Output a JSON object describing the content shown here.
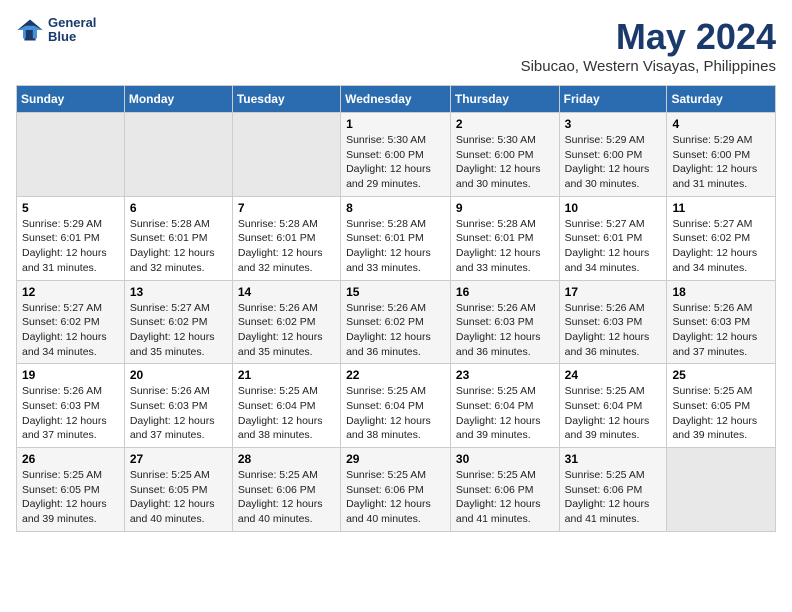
{
  "logo": {
    "line1": "General",
    "line2": "Blue"
  },
  "title": "May 2024",
  "subtitle": "Sibucao, Western Visayas, Philippines",
  "days_header": [
    "Sunday",
    "Monday",
    "Tuesday",
    "Wednesday",
    "Thursday",
    "Friday",
    "Saturday"
  ],
  "weeks": [
    [
      {
        "num": "",
        "info": ""
      },
      {
        "num": "",
        "info": ""
      },
      {
        "num": "",
        "info": ""
      },
      {
        "num": "1",
        "info": "Sunrise: 5:30 AM\nSunset: 6:00 PM\nDaylight: 12 hours\nand 29 minutes."
      },
      {
        "num": "2",
        "info": "Sunrise: 5:30 AM\nSunset: 6:00 PM\nDaylight: 12 hours\nand 30 minutes."
      },
      {
        "num": "3",
        "info": "Sunrise: 5:29 AM\nSunset: 6:00 PM\nDaylight: 12 hours\nand 30 minutes."
      },
      {
        "num": "4",
        "info": "Sunrise: 5:29 AM\nSunset: 6:00 PM\nDaylight: 12 hours\nand 31 minutes."
      }
    ],
    [
      {
        "num": "5",
        "info": "Sunrise: 5:29 AM\nSunset: 6:01 PM\nDaylight: 12 hours\nand 31 minutes."
      },
      {
        "num": "6",
        "info": "Sunrise: 5:28 AM\nSunset: 6:01 PM\nDaylight: 12 hours\nand 32 minutes."
      },
      {
        "num": "7",
        "info": "Sunrise: 5:28 AM\nSunset: 6:01 PM\nDaylight: 12 hours\nand 32 minutes."
      },
      {
        "num": "8",
        "info": "Sunrise: 5:28 AM\nSunset: 6:01 PM\nDaylight: 12 hours\nand 33 minutes."
      },
      {
        "num": "9",
        "info": "Sunrise: 5:28 AM\nSunset: 6:01 PM\nDaylight: 12 hours\nand 33 minutes."
      },
      {
        "num": "10",
        "info": "Sunrise: 5:27 AM\nSunset: 6:01 PM\nDaylight: 12 hours\nand 34 minutes."
      },
      {
        "num": "11",
        "info": "Sunrise: 5:27 AM\nSunset: 6:02 PM\nDaylight: 12 hours\nand 34 minutes."
      }
    ],
    [
      {
        "num": "12",
        "info": "Sunrise: 5:27 AM\nSunset: 6:02 PM\nDaylight: 12 hours\nand 34 minutes."
      },
      {
        "num": "13",
        "info": "Sunrise: 5:27 AM\nSunset: 6:02 PM\nDaylight: 12 hours\nand 35 minutes."
      },
      {
        "num": "14",
        "info": "Sunrise: 5:26 AM\nSunset: 6:02 PM\nDaylight: 12 hours\nand 35 minutes."
      },
      {
        "num": "15",
        "info": "Sunrise: 5:26 AM\nSunset: 6:02 PM\nDaylight: 12 hours\nand 36 minutes."
      },
      {
        "num": "16",
        "info": "Sunrise: 5:26 AM\nSunset: 6:03 PM\nDaylight: 12 hours\nand 36 minutes."
      },
      {
        "num": "17",
        "info": "Sunrise: 5:26 AM\nSunset: 6:03 PM\nDaylight: 12 hours\nand 36 minutes."
      },
      {
        "num": "18",
        "info": "Sunrise: 5:26 AM\nSunset: 6:03 PM\nDaylight: 12 hours\nand 37 minutes."
      }
    ],
    [
      {
        "num": "19",
        "info": "Sunrise: 5:26 AM\nSunset: 6:03 PM\nDaylight: 12 hours\nand 37 minutes."
      },
      {
        "num": "20",
        "info": "Sunrise: 5:26 AM\nSunset: 6:03 PM\nDaylight: 12 hours\nand 37 minutes."
      },
      {
        "num": "21",
        "info": "Sunrise: 5:25 AM\nSunset: 6:04 PM\nDaylight: 12 hours\nand 38 minutes."
      },
      {
        "num": "22",
        "info": "Sunrise: 5:25 AM\nSunset: 6:04 PM\nDaylight: 12 hours\nand 38 minutes."
      },
      {
        "num": "23",
        "info": "Sunrise: 5:25 AM\nSunset: 6:04 PM\nDaylight: 12 hours\nand 39 minutes."
      },
      {
        "num": "24",
        "info": "Sunrise: 5:25 AM\nSunset: 6:04 PM\nDaylight: 12 hours\nand 39 minutes."
      },
      {
        "num": "25",
        "info": "Sunrise: 5:25 AM\nSunset: 6:05 PM\nDaylight: 12 hours\nand 39 minutes."
      }
    ],
    [
      {
        "num": "26",
        "info": "Sunrise: 5:25 AM\nSunset: 6:05 PM\nDaylight: 12 hours\nand 39 minutes."
      },
      {
        "num": "27",
        "info": "Sunrise: 5:25 AM\nSunset: 6:05 PM\nDaylight: 12 hours\nand 40 minutes."
      },
      {
        "num": "28",
        "info": "Sunrise: 5:25 AM\nSunset: 6:06 PM\nDaylight: 12 hours\nand 40 minutes."
      },
      {
        "num": "29",
        "info": "Sunrise: 5:25 AM\nSunset: 6:06 PM\nDaylight: 12 hours\nand 40 minutes."
      },
      {
        "num": "30",
        "info": "Sunrise: 5:25 AM\nSunset: 6:06 PM\nDaylight: 12 hours\nand 41 minutes."
      },
      {
        "num": "31",
        "info": "Sunrise: 5:25 AM\nSunset: 6:06 PM\nDaylight: 12 hours\nand 41 minutes."
      },
      {
        "num": "",
        "info": ""
      }
    ]
  ]
}
